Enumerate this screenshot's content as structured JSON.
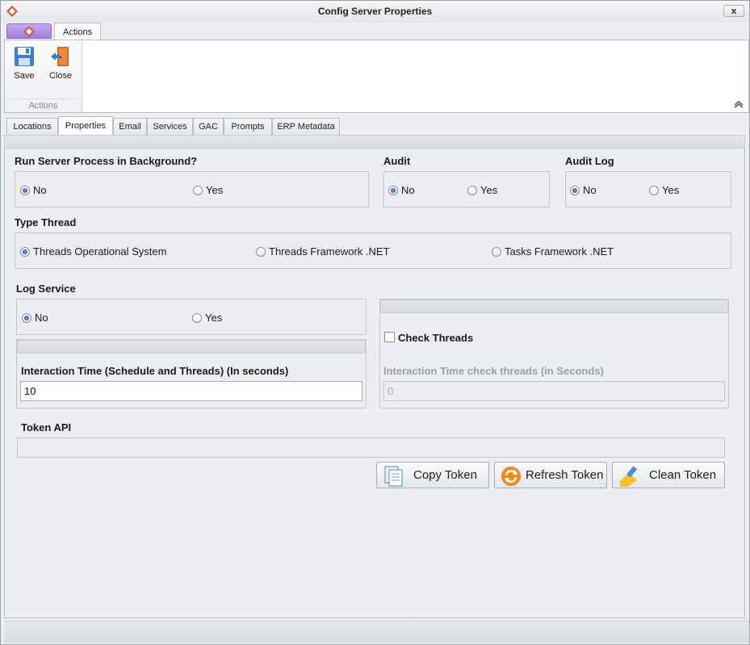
{
  "window": {
    "title": "Config Server Properties",
    "close_label": "x"
  },
  "ribbon": {
    "tab": "Actions",
    "group_label": "Actions",
    "buttons": {
      "save": "Save",
      "close": "Close"
    }
  },
  "tabs": [
    "Locations",
    "Properties",
    "Email",
    "Services",
    "GAC",
    "Prompts",
    "ERP Metadata"
  ],
  "active_tab": "Properties",
  "run_background": {
    "label": "Run Server Process in Background?",
    "options": [
      "No",
      "Yes"
    ],
    "selected": "No"
  },
  "audit": {
    "label": "Audit",
    "options": [
      "No",
      "Yes"
    ],
    "selected": "No"
  },
  "audit_log": {
    "label": "Audit Log",
    "options": [
      "No",
      "Yes"
    ],
    "selected": "No"
  },
  "type_thread": {
    "label": "Type Thread",
    "options": [
      "Threads Operational System",
      "Threads Framework .NET",
      "Tasks Framework .NET"
    ],
    "selected": "Threads Operational System"
  },
  "log_service": {
    "label": "Log Service",
    "options": [
      "No",
      "Yes"
    ],
    "selected": "No"
  },
  "interaction_time": {
    "label": "Interaction Time (Schedule and Threads) (In seconds)",
    "value": "10"
  },
  "check_threads": {
    "label": "Check Threads",
    "checked": false
  },
  "check_interval": {
    "label": "Interaction Time check threads (in Seconds)",
    "value": "0"
  },
  "token": {
    "label": "Token API",
    "value": ""
  },
  "token_buttons": {
    "copy": "Copy Token",
    "refresh": "Refresh Token",
    "clean": "Clean Token"
  },
  "colors": {
    "accent": "#2f56b0",
    "app_button": "#b08ee8",
    "disabled_text": "#9aa0a8"
  }
}
